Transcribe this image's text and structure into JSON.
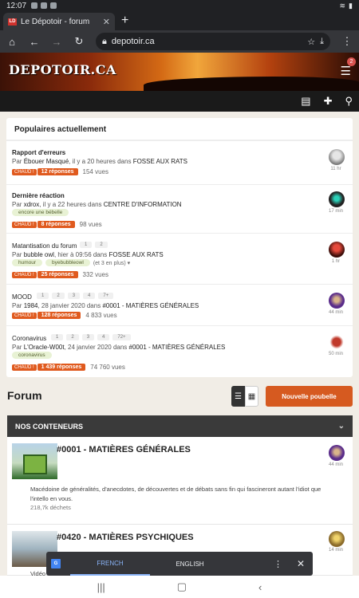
{
  "status_bar": {
    "time": "12:07"
  },
  "browser": {
    "tab_title": "Le Dépotoir - forum",
    "url": "depotoir.ca",
    "new_tab": "+"
  },
  "site": {
    "logo": "DEPOTOIR.CA",
    "notif_count": "2"
  },
  "popular": {
    "title": "Populaires actuellement",
    "hot_label": "CHAUD !",
    "topics": [
      {
        "title": "Rapport d'erreurs",
        "by": "Par",
        "user": "Ébouer Masqué",
        "when": ", il y a 20 heures dans",
        "category": "FOSSE AUX RATS",
        "replies": "12 réponses",
        "views": "154 vues",
        "time": "11 hr"
      },
      {
        "title": "Dernière réaction",
        "by": "Par",
        "user": "xdrox",
        "when": ", il y a 22 heures dans",
        "category": "CENTRE D'INFORMATION",
        "tags": [
          "encore une bébelle"
        ],
        "replies": "8 réponses",
        "views": "98 vues",
        "time": "17 min"
      },
      {
        "title": "Matantisation du forum",
        "pages": [
          "1",
          "2"
        ],
        "by": "Par",
        "user": "bubble owl",
        "when": ", hier à 09:56 dans",
        "category": "FOSSE AUX RATS",
        "tags": [
          "humour",
          "byebubbleowl"
        ],
        "tags_more": "(et 3 en plus) ▾",
        "replies": "25 réponses",
        "views": "332 vues",
        "time": "1 hr"
      },
      {
        "title": "MOOD",
        "pages": [
          "1",
          "2",
          "3",
          "4",
          "7+"
        ],
        "by": "Par",
        "user": "1984",
        "when": ", 28 janvier 2020 dans",
        "category": "#0001 - MATIÈRES GÉNÉRALES",
        "replies": "128 réponses",
        "views": "4 833 vues",
        "time": "44 min"
      },
      {
        "title": "Coronavirus",
        "pages": [
          "1",
          "2",
          "3",
          "4",
          "72+"
        ],
        "by": "Par",
        "user": "L'Oracle-W00t",
        "when": ", 24 janvier 2020 dans",
        "category": "#0001 - MATIÈRES GÉNÉRALES",
        "tags": [
          "coronavirus"
        ],
        "replies": "1 439 réponses",
        "views": "74 760 vues",
        "time": "50 min"
      }
    ]
  },
  "forum": {
    "title": "Forum",
    "new_button": "Nouvelle poubelle",
    "containers_title": "NOS CONTENEURS",
    "categories": [
      {
        "name": "#0001 - MATIÈRES GÉNÉRALES",
        "description": "Macédoine de généralités, d'anecdotes, de découvertes et de débats sans fin qui fascineront autant l'idiot que l'intello en vous.",
        "count": "218,7k déchets",
        "time": "44 min"
      },
      {
        "name": "#0420 - MATIÈRES PSYCHIQUES",
        "description_partial": "Vidéo",
        "time": "14 min"
      }
    ]
  },
  "translate": {
    "lang_active": "FRENCH",
    "lang_other": "ENGLISH",
    "logo": "G"
  },
  "colors": {
    "accent": "#d65a20",
    "hot": "#e05a1e"
  }
}
